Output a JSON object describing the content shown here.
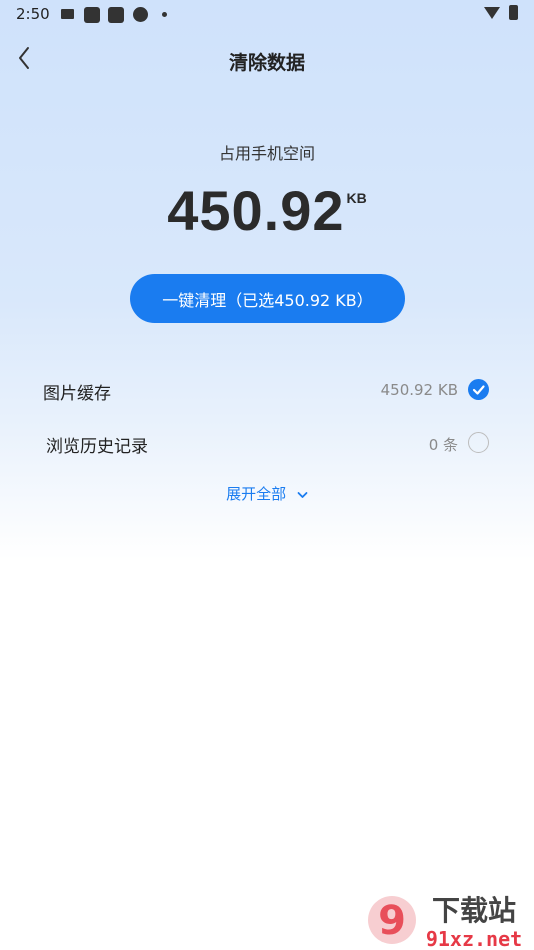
{
  "status_bar": {
    "time": "2:50",
    "icons": [
      "mail-icon",
      "app-icon",
      "app-icon",
      "aperture-icon",
      "dot-icon",
      "wifi-icon",
      "battery-icon"
    ]
  },
  "header": {
    "title": "清除数据",
    "back_icon": "chevron-left-icon"
  },
  "storage": {
    "label": "占用手机空间",
    "value": "450.92",
    "unit": "KB"
  },
  "clean_button": {
    "label": "一键清理（已选450.92 KB）"
  },
  "items": [
    {
      "label": "图片缓存",
      "value": "450.92 KB",
      "checked": true
    },
    {
      "label": "浏览历史记录",
      "value": "0 条",
      "checked": false
    }
  ],
  "expand": {
    "label": "展开全部"
  },
  "colors": {
    "accent": "#1a7cf0",
    "background_top": "#cfe2fb",
    "text_primary": "#222222",
    "text_secondary": "#8a8a8a"
  },
  "watermark": {
    "text_top": "下载站",
    "text_bottom": "91xz.net",
    "logo": "9"
  }
}
